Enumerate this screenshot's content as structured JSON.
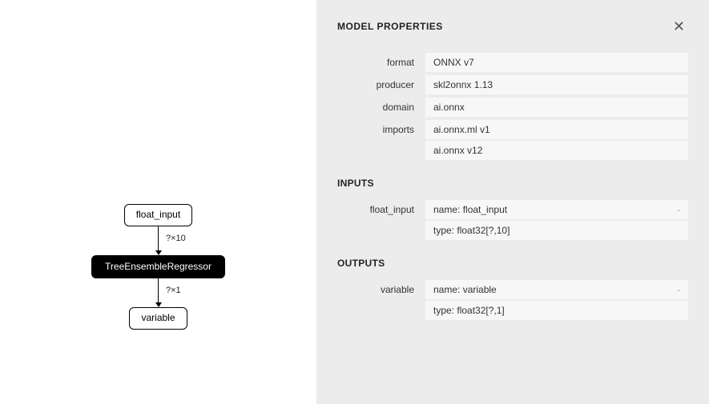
{
  "graph": {
    "input_node": "float_input",
    "edge1_label": "?×10",
    "op_node": "TreeEnsembleRegressor",
    "edge2_label": "?×1",
    "output_node": "variable"
  },
  "panel": {
    "title": "MODEL PROPERTIES",
    "close_glyph": "✕",
    "model": {
      "rows": [
        {
          "label": "format",
          "values": [
            "ONNX v7"
          ]
        },
        {
          "label": "producer",
          "values": [
            "skl2onnx 1.13"
          ]
        },
        {
          "label": "domain",
          "values": [
            "ai.onnx"
          ]
        },
        {
          "label": "imports",
          "values": [
            "ai.onnx.ml v1",
            "ai.onnx v12"
          ]
        }
      ]
    },
    "inputs": {
      "title": "INPUTS",
      "rows": [
        {
          "label": "float_input",
          "kv": [
            {
              "k": "name:",
              "v": "float_input",
              "strong": true,
              "expandable": true
            },
            {
              "k": "type:",
              "v": "float32[?,10]"
            }
          ]
        }
      ]
    },
    "outputs": {
      "title": "OUTPUTS",
      "rows": [
        {
          "label": "variable",
          "kv": [
            {
              "k": "name:",
              "v": "variable",
              "strong": true,
              "expandable": true
            },
            {
              "k": "type:",
              "v": "float32[?,1]"
            }
          ]
        }
      ]
    }
  }
}
